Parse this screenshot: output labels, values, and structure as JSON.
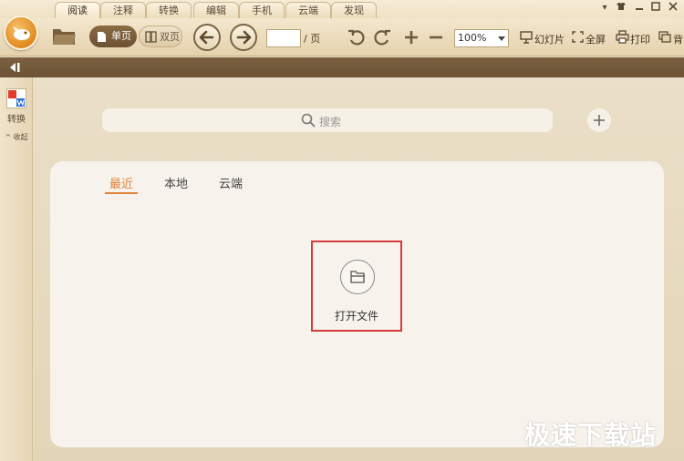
{
  "tabs": [
    "阅读",
    "注释",
    "转换",
    "编辑",
    "手机",
    "云端",
    "发现"
  ],
  "window_controls": [
    "menu",
    "skin",
    "minimize",
    "maximize",
    "close"
  ],
  "toolbar": {
    "single_page": "单页",
    "double_page": "双页",
    "page_input_value": "",
    "page_suffix": "/ 页",
    "zoom": "100%",
    "slideshow": "幻灯片",
    "fullscreen": "全屏",
    "print": "打印",
    "background": "背"
  },
  "sidebar": {
    "convert_label": "转换",
    "collapse_label": "收起"
  },
  "search": {
    "placeholder": "搜索"
  },
  "panel": {
    "tabs": [
      "最近",
      "本地",
      "云端"
    ],
    "active_tab": "最近",
    "open_file": "打开文件"
  },
  "watermark": "极速下载站",
  "colors": {
    "accent": "#e0823a",
    "highlight_box": "#d63a3a",
    "toolbar_dark": "#6c5334"
  },
  "icons": [
    "app-logo-icon",
    "folder-open-icon",
    "single-page-icon",
    "double-page-icon",
    "back-arrow-icon",
    "forward-arrow-icon",
    "rotate-left-icon",
    "rotate-right-icon",
    "zoom-in-icon",
    "zoom-out-icon",
    "slideshow-icon",
    "fullscreen-icon",
    "print-icon",
    "background-icon",
    "collapse-sidebar-icon",
    "convert-icon",
    "search-icon",
    "add-icon",
    "folder-icon"
  ]
}
